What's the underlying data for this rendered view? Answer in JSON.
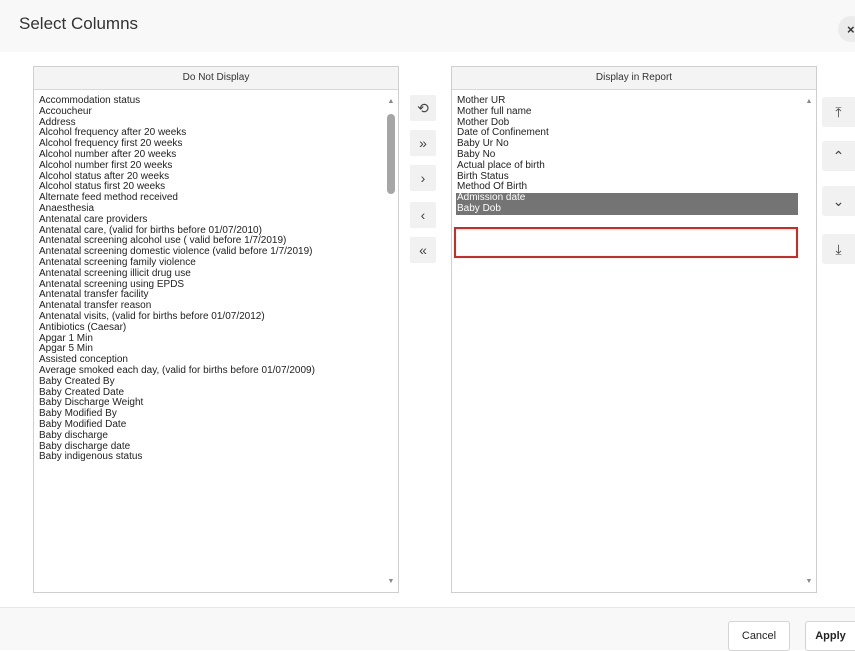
{
  "dialog": {
    "title": "Select Columns",
    "close_label": "×"
  },
  "left_panel": {
    "header": "Do Not Display",
    "items": [
      "Accommodation status",
      "Accoucheur",
      "Address",
      "Alcohol frequency after 20 weeks",
      "Alcohol frequency first 20 weeks",
      "Alcohol number after 20 weeks",
      "Alcohol number first 20 weeks",
      "Alcohol status after 20 weeks",
      "Alcohol status first 20 weeks",
      "Alternate feed method received",
      "Anaesthesia",
      "Antenatal care providers",
      "Antenatal care, (valid for births before 01/07/2010)",
      "Antenatal screening alcohol use ( valid before 1/7/2019)",
      "Antenatal screening domestic violence (valid before 1/7/2019)",
      "Antenatal screening family violence",
      "Antenatal screening illicit drug use",
      "Antenatal screening using EPDS",
      "Antenatal transfer facility",
      "Antenatal transfer reason",
      "Antenatal visits, (valid for births before 01/07/2012)",
      "Antibiotics (Caesar)",
      "Apgar 1 Min",
      "Apgar 5 Min",
      "Assisted conception",
      "Average smoked each day, (valid for births before 01/07/2009)",
      "Baby Created By",
      "Baby Created Date",
      "Baby Discharge Weight",
      "Baby Modified By",
      "Baby Modified Date",
      "Baby discharge",
      "Baby discharge date",
      "Baby indigenous status"
    ]
  },
  "right_panel": {
    "header": "Display in Report",
    "items": [
      {
        "label": "Mother UR",
        "selected": false
      },
      {
        "label": "Mother full name",
        "selected": false
      },
      {
        "label": "Mother Dob",
        "selected": false
      },
      {
        "label": "Date of Confinement",
        "selected": false
      },
      {
        "label": "Baby Ur No",
        "selected": false
      },
      {
        "label": "Baby No",
        "selected": false
      },
      {
        "label": "Actual place of birth",
        "selected": false
      },
      {
        "label": "Birth Status",
        "selected": false
      },
      {
        "label": "Method Of Birth",
        "selected": false
      },
      {
        "label": "Admission date",
        "selected": true
      },
      {
        "label": "Baby Dob",
        "selected": true
      }
    ]
  },
  "transfer_buttons": [
    {
      "name": "reset-button",
      "icon": "reset-icon",
      "glyph": "⟲"
    },
    {
      "name": "move-all-right-button",
      "icon": "double-chevron-right-icon",
      "glyph": "»"
    },
    {
      "name": "move-right-button",
      "icon": "chevron-right-icon",
      "glyph": "›"
    },
    {
      "name": "move-left-button",
      "icon": "chevron-left-icon",
      "glyph": "‹"
    },
    {
      "name": "move-all-left-button",
      "icon": "double-chevron-left-icon",
      "glyph": "«"
    }
  ],
  "order_buttons": [
    {
      "name": "move-top-button",
      "icon": "move-top-icon",
      "glyph": "⤒"
    },
    {
      "name": "move-up-button",
      "icon": "chevron-up-icon",
      "glyph": "⌃"
    },
    {
      "name": "move-down-button",
      "icon": "chevron-down-icon",
      "glyph": "⌄"
    },
    {
      "name": "move-bottom-button",
      "icon": "move-bottom-icon",
      "glyph": "⤓"
    }
  ],
  "footer": {
    "cancel_label": "Cancel",
    "apply_label": "Apply"
  },
  "colors": {
    "selection_bg": "#747474",
    "selection_outline": "#d9261c"
  }
}
